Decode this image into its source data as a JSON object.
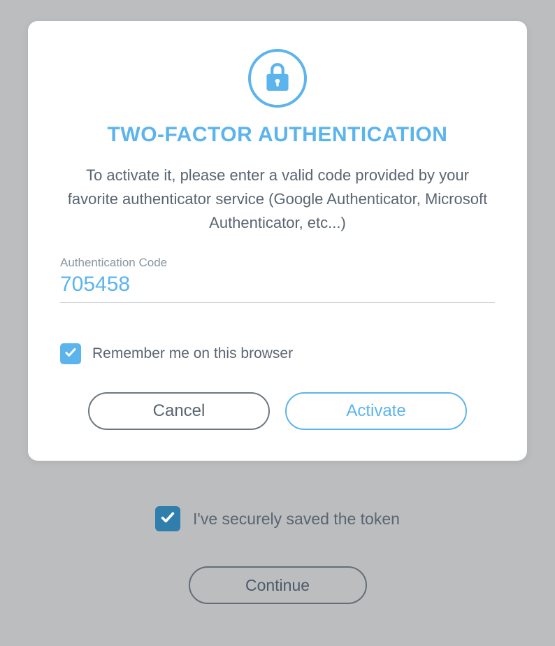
{
  "modal": {
    "title": "TWO-FACTOR AUTHENTICATION",
    "description": "To activate it, please enter a valid code provided by your favorite authenticator service (Google Authenticator, Microsoft Authenticator, etc...)",
    "code_label": "Authentication Code",
    "code_value": "705458",
    "remember_label": "Remember me on this browser",
    "remember_checked": true,
    "cancel_label": "Cancel",
    "activate_label": "Activate"
  },
  "background": {
    "saved_label": "I've securely saved the token",
    "saved_checked": true,
    "continue_label": "Continue"
  },
  "colors": {
    "accent": "#5cb4ed",
    "text": "#5a6571",
    "bg_overlay": "#bbbdbf",
    "bg_checkbox": "#2f7eab"
  }
}
